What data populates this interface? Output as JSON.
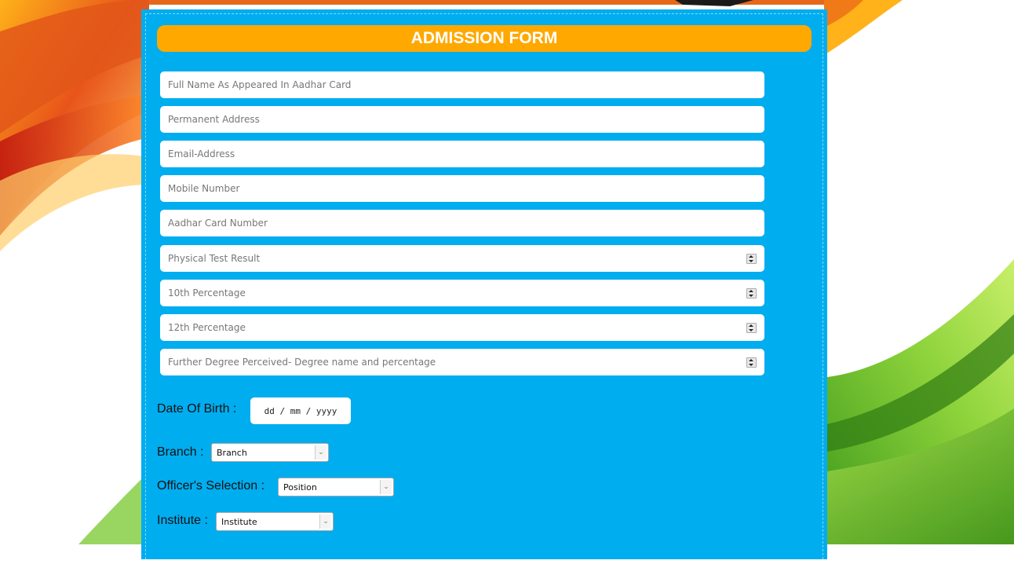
{
  "form": {
    "title": "ADMISSION FORM",
    "fields": [
      {
        "placeholder": "Full Name As Appeared In Aadhar Card",
        "spinner": false
      },
      {
        "placeholder": "Permanent Address",
        "spinner": false
      },
      {
        "placeholder": "Email-Address",
        "spinner": false
      },
      {
        "placeholder": "Mobile Number",
        "spinner": false
      },
      {
        "placeholder": "Aadhar Card Number",
        "spinner": false
      },
      {
        "placeholder": "Physical Test Result",
        "spinner": true
      },
      {
        "placeholder": "10th Percentage",
        "spinner": true
      },
      {
        "placeholder": "12th Percentage",
        "spinner": true
      },
      {
        "placeholder": "Further Degree Perceived- Degree name and percentage",
        "spinner": true
      }
    ],
    "dob": {
      "label": "Date Of Birth :",
      "value": "dd / mm / yyyy"
    },
    "branch": {
      "label": "Branch :",
      "selected": "Branch"
    },
    "officer": {
      "label": "Officer's Selection :",
      "selected": "Position"
    },
    "institute": {
      "label": "Institute :",
      "selected": "Institute"
    }
  },
  "colors": {
    "panel": "#00adef",
    "header": "#ffa800",
    "saffron": "#f47a1f",
    "green": "#6cc23a"
  }
}
